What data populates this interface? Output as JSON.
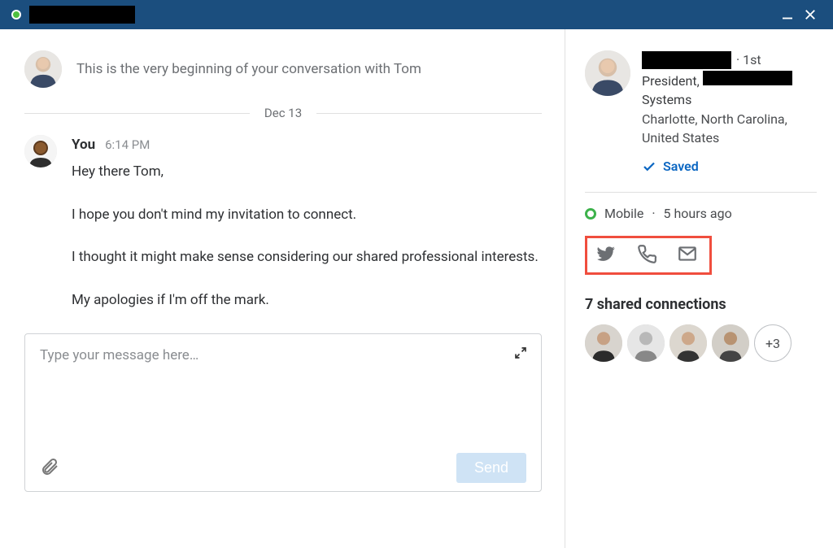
{
  "conversation": {
    "intro_text": "This is the very beginning of your conversation with Tom",
    "date_label": "Dec 13",
    "message": {
      "author": "You",
      "time": "6:14 PM",
      "body": "Hey there Tom,\n\nI hope you don't mind my invitation to connect.\n\nI thought it might make sense considering our shared professional interests.\n\nMy apologies if I'm off the mark."
    },
    "composer_placeholder": "Type your message here…",
    "send_label": "Send"
  },
  "profile": {
    "degree": "· 1st",
    "title_prefix": "President, ",
    "company_suffix": "Systems",
    "location": "Charlotte, North Carolina, United States",
    "saved_label": "Saved",
    "presence_label": "Mobile",
    "presence_time": "5 hours ago"
  },
  "shared": {
    "title": "7 shared connections",
    "more_label": "+3"
  }
}
